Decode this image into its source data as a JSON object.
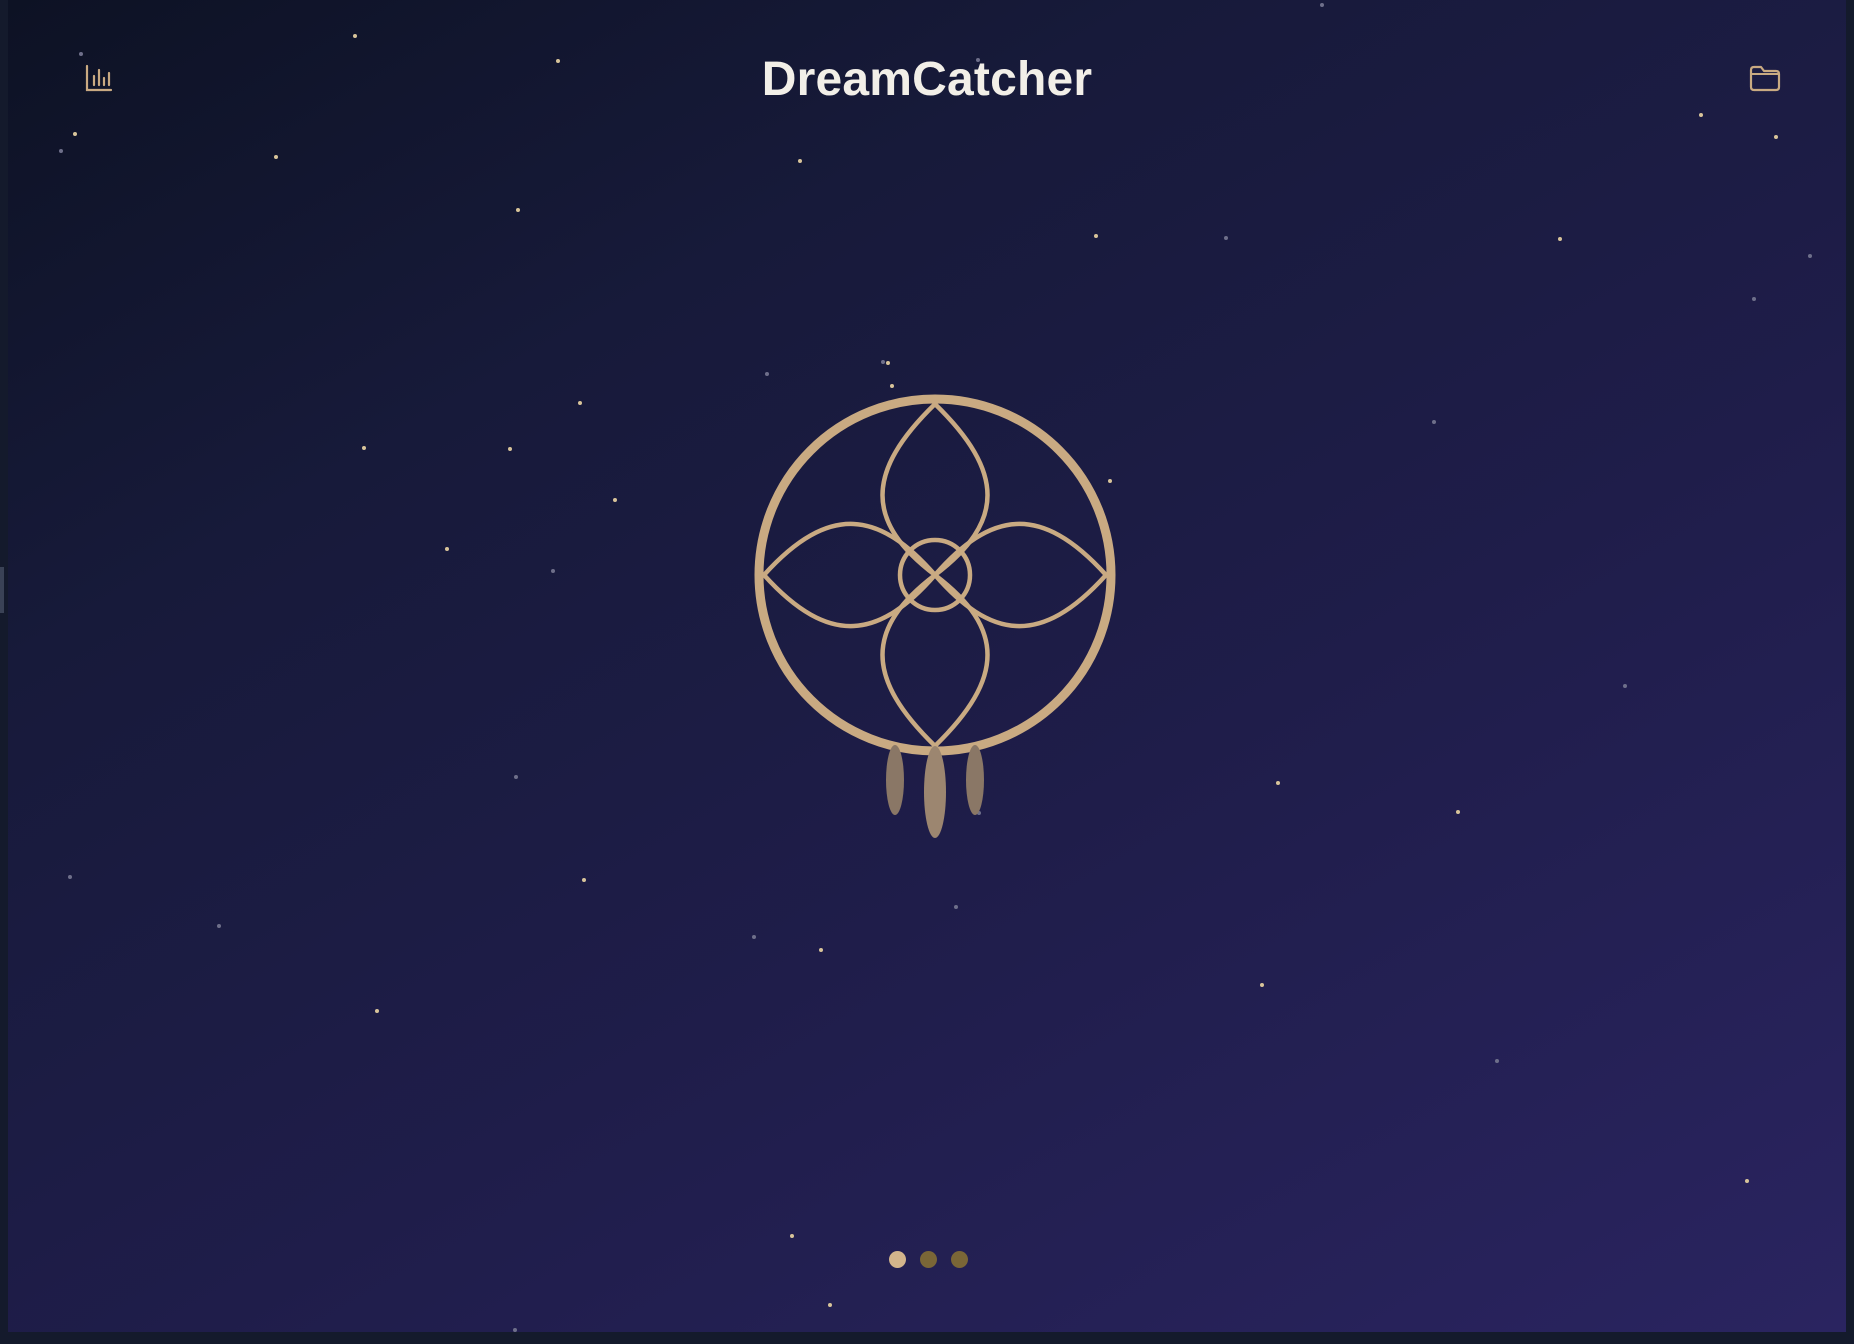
{
  "app": {
    "title": "DreamCatcher"
  },
  "header": {
    "left_icon": "bar-chart-icon",
    "right_icon": "folder-icon"
  },
  "logo": {
    "icon": "dreamcatcher-logo",
    "color": "#c9aa82",
    "feather_color": "#8a7766"
  },
  "pager": {
    "pages": [
      {
        "active": true
      },
      {
        "active": false
      },
      {
        "active": false
      }
    ],
    "active_color": "#d3b58c",
    "inactive_color": "#7a6637"
  },
  "colors": {
    "accent": "#c9aa82",
    "title": "#f2efe8",
    "background_start": "#0d1224",
    "background_end": "#2a2460",
    "star": "#d8c49a"
  }
}
